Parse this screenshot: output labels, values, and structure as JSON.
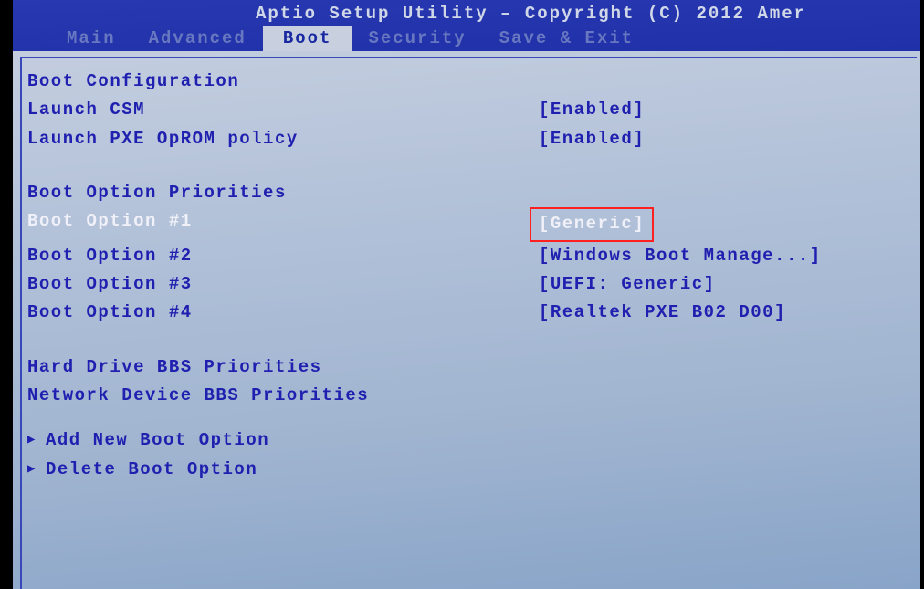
{
  "header": {
    "title": "Aptio Setup Utility – Copyright (C) 2012 Amer"
  },
  "tabs": {
    "main": "Main",
    "advanced": "Advanced",
    "boot": "Boot",
    "security": "Security",
    "save_exit": "Save & Exit"
  },
  "sections": {
    "boot_config": {
      "title": "Boot Configuration",
      "items": [
        {
          "label": "Launch CSM",
          "value": "[Enabled]"
        },
        {
          "label": "Launch PXE OpROM policy",
          "value": "[Enabled]"
        }
      ]
    },
    "boot_priorities": {
      "title": "Boot Option Priorities",
      "items": [
        {
          "label": "Boot Option #1",
          "value": "[Generic]",
          "selected": true
        },
        {
          "label": "Boot Option #2",
          "value": "[Windows Boot Manage...]"
        },
        {
          "label": "Boot Option #3",
          "value": "[UEFI: Generic]"
        },
        {
          "label": "Boot Option #4",
          "value": "[Realtek PXE B02 D00]"
        }
      ]
    },
    "bbs": {
      "hard_drive": "Hard Drive BBS Priorities",
      "network": "Network Device BBS Priorities"
    },
    "actions": {
      "add": "Add New Boot Option",
      "delete": "Delete Boot Option"
    }
  }
}
